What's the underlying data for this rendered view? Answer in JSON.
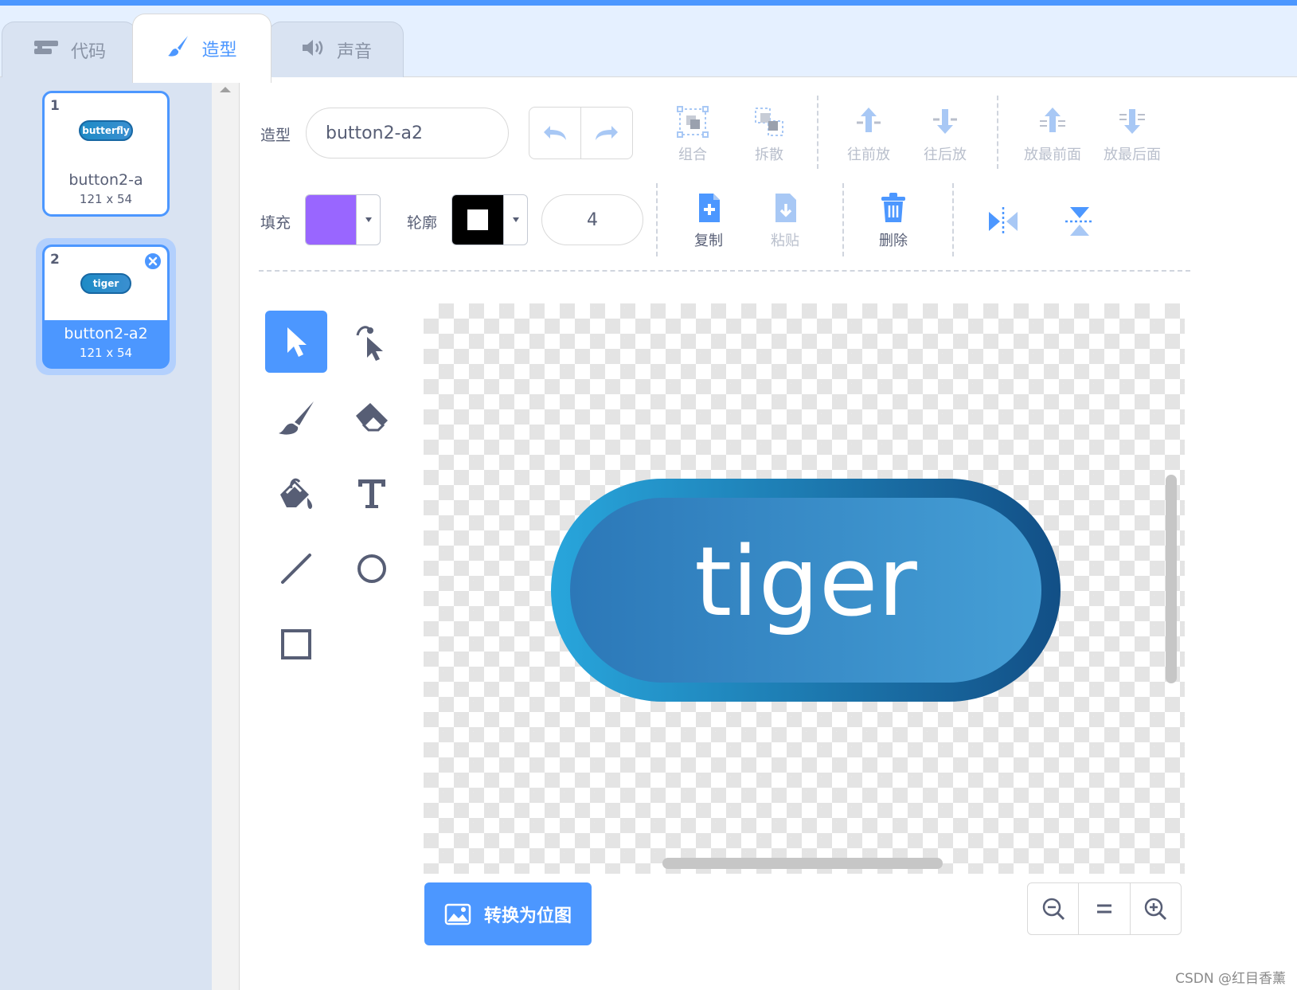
{
  "tabs": [
    {
      "label": "代码",
      "icon": "code-blocks-icon"
    },
    {
      "label": "造型",
      "icon": "paintbrush-icon"
    },
    {
      "label": "声音",
      "icon": "speaker-icon"
    }
  ],
  "costumes": [
    {
      "number": "1",
      "thumb_text": "butterfly",
      "name": "button2-a",
      "size": "121 x 54"
    },
    {
      "number": "2",
      "thumb_text": "tiger",
      "name": "button2-a2",
      "size": "121 x 54"
    }
  ],
  "toolbar": {
    "costume_label": "造型",
    "costume_name": "button2-a2",
    "group": "组合",
    "ungroup": "拆散",
    "forward": "往前放",
    "backward": "往后放",
    "front": "放最前面",
    "back": "放最后面",
    "fill_label": "填充",
    "outline_label": "轮廓",
    "outline_width": "4",
    "copy": "复制",
    "paste": "粘贴",
    "delete": "删除"
  },
  "colors": {
    "accent": "#4c97ff",
    "fill": "#9966ff",
    "outline": "#000000",
    "button_blue": "#2f86c9"
  },
  "canvas": {
    "text": "tiger"
  },
  "convert_button": "转换为位图",
  "watermark": "CSDN @红目香薰"
}
